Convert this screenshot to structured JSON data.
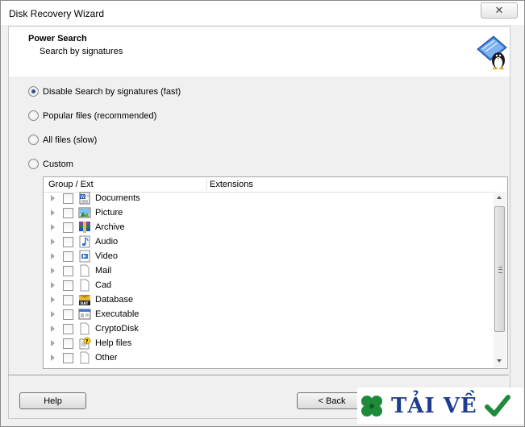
{
  "window": {
    "title": "Disk Recovery Wizard",
    "close_label": "✕"
  },
  "header": {
    "title": "Power Search",
    "subtitle": "Search by signatures"
  },
  "options": [
    {
      "label": "Disable Search by signatures (fast)",
      "selected": true
    },
    {
      "label": "Popular files (recommended)",
      "selected": false
    },
    {
      "label": "All files (slow)",
      "selected": false
    },
    {
      "label": "Custom",
      "selected": false
    }
  ],
  "table": {
    "columns": [
      "Group / Ext",
      "Extensions"
    ],
    "rows": [
      {
        "label": "Documents",
        "icon": "word-document-icon"
      },
      {
        "label": "Picture",
        "icon": "picture-icon"
      },
      {
        "label": "Archive",
        "icon": "archive-icon"
      },
      {
        "label": "Audio",
        "icon": "audio-icon"
      },
      {
        "label": "Video",
        "icon": "video-icon"
      },
      {
        "label": "Mail",
        "icon": "blank-file-icon"
      },
      {
        "label": "Cad",
        "icon": "blank-file-icon"
      },
      {
        "label": "Database",
        "icon": "database-icon"
      },
      {
        "label": "Executable",
        "icon": "executable-icon"
      },
      {
        "label": "CryptoDisk",
        "icon": "blank-file-icon"
      },
      {
        "label": "Help files",
        "icon": "help-file-icon"
      },
      {
        "label": "Other",
        "icon": "blank-file-icon"
      }
    ]
  },
  "footer": {
    "help_label": "Help",
    "back_label": "< Back"
  },
  "watermark": {
    "text": "TẢI VỀ"
  },
  "colors": {
    "accent": "#2a4f8a",
    "watermark": "#1b3c8f",
    "clover": "#1f8a3c"
  }
}
